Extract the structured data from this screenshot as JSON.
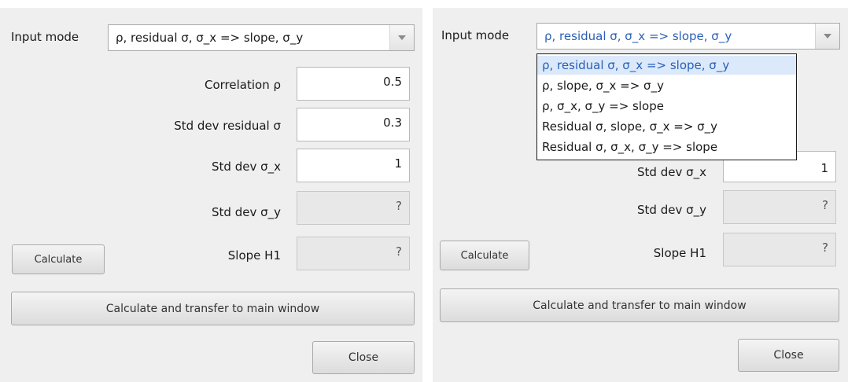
{
  "left": {
    "input_mode_label": "Input mode",
    "input_mode_value": "ρ, residual σ, σ_x => slope, σ_y",
    "fields": [
      {
        "label": "Correlation ρ",
        "value": "0.5"
      },
      {
        "label": "Std dev residual σ",
        "value": "0.3"
      },
      {
        "label": "Std dev σ_x",
        "value": "1"
      },
      {
        "label": "Std dev σ_y",
        "value": "?"
      },
      {
        "label": "Slope H1",
        "value": "?"
      }
    ],
    "calculate_label": "Calculate",
    "transfer_label": "Calculate and transfer to main window",
    "close_label": "Close"
  },
  "right": {
    "input_mode_label": "Input mode",
    "input_mode_value": "ρ, residual σ, σ_x => slope, σ_y",
    "dropdown_options": [
      "ρ, residual σ, σ_x => slope, σ_y",
      "ρ, slope, σ_x => σ_y",
      "ρ, σ_x, σ_y => slope",
      "Residual σ, slope, σ_x => σ_y",
      "Residual σ, σ_x, σ_y => slope"
    ],
    "visible_partial_label": "Std dev σ_x",
    "visible_partial_value": "1",
    "fields": [
      {
        "label": "Std dev σ_y",
        "value": "?"
      },
      {
        "label": "Slope H1",
        "value": "?"
      }
    ],
    "calculate_label": "Calculate",
    "transfer_label": "Calculate and transfer to main window",
    "close_label": "Close"
  },
  "colors": {
    "panel_bg": "#efefef",
    "selection_bg": "#dbe9fb",
    "selection_text": "#2a5fb6"
  }
}
